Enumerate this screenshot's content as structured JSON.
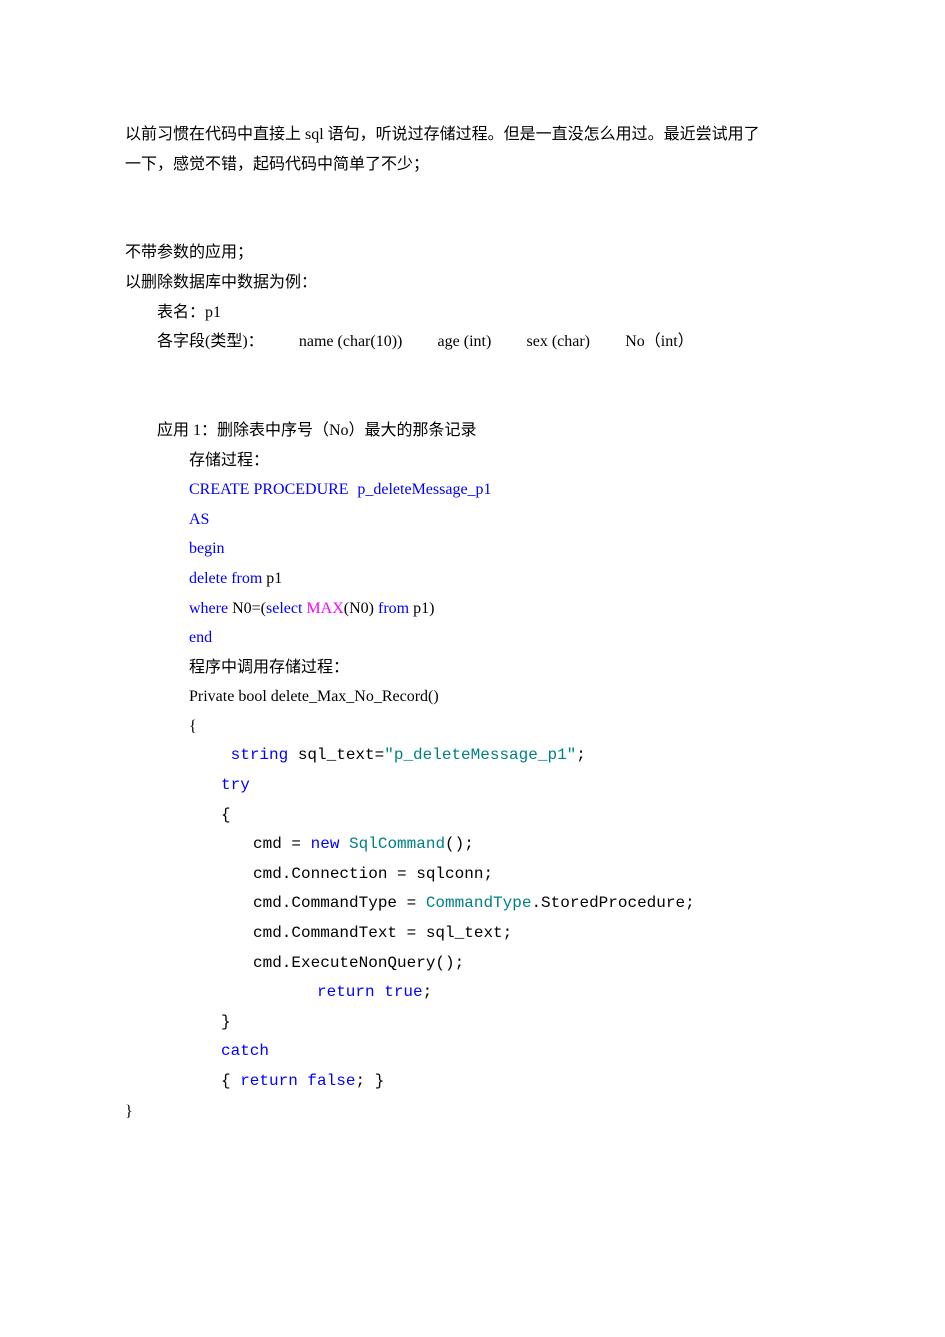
{
  "intro": {
    "line1": "以前习惯在代码中直接上 sql 语句，听说过存储过程。但是一直没怎么用过。最近尝试用了",
    "line2": "一下，感觉不错，起码代码中简单了不少；"
  },
  "sec_noparam": {
    "title": "不带参数的应用；",
    "example_intro": "以删除数据库中数据为例：",
    "table_label": "表名：p1",
    "fields_label": "各字段(类型)：",
    "f_name": "name (char(10))",
    "f_age": "age (int)",
    "f_sex": "sex (char)",
    "f_no": "No（int）"
  },
  "app1": {
    "title": "应用 1：删除表中序号（No）最大的那条记录",
    "proc_label": "存储过程：",
    "sql": {
      "create": "CREATE    PROCEDURE",
      "proc_name": "p_deleteMessage_p1",
      "as": "AS",
      "begin": "begin",
      "delete_from": "delete from ",
      "table": "p1",
      "where": "where ",
      "n0eq": "N0=(",
      "select": "select ",
      "max": "MAX",
      "max_arg": "(N0) ",
      "from": "from ",
      "from_table": "p1)",
      "end": "end"
    },
    "call_label": "程序中调用存储过程：",
    "code": {
      "sig": "Private bool delete_Max_No_Record()",
      "brace_open": "{",
      "string_kw": "string",
      "var_decl": " sql_text=",
      "string_lit": "\"p_deleteMessage_p1\"",
      "semi": ";",
      "try": "try",
      "brace_open2": "{",
      "cmd_new": "cmd = ",
      "new_kw": "new",
      "sqlcommand": "SqlCommand",
      "sqlcommand_tail": "();",
      "cmd_conn": "cmd.Connection = sqlconn;",
      "cmd_type_lhs": "cmd.CommandType = ",
      "commandtype": "CommandType",
      "cmd_type_rhs": ".StoredProcedure;",
      "cmd_text": "cmd.CommandText = sql_text;",
      "cmd_exec": "cmd.ExecuteNonQuery();",
      "return_kw": "return",
      "true_kw": "true",
      "semi2": ";",
      "brace_close2": "}",
      "catch": "catch",
      "catch_body_open": "{ ",
      "return_kw2": "return",
      "false_kw": "false",
      "catch_body_close": "; }",
      "brace_close": "}"
    }
  }
}
